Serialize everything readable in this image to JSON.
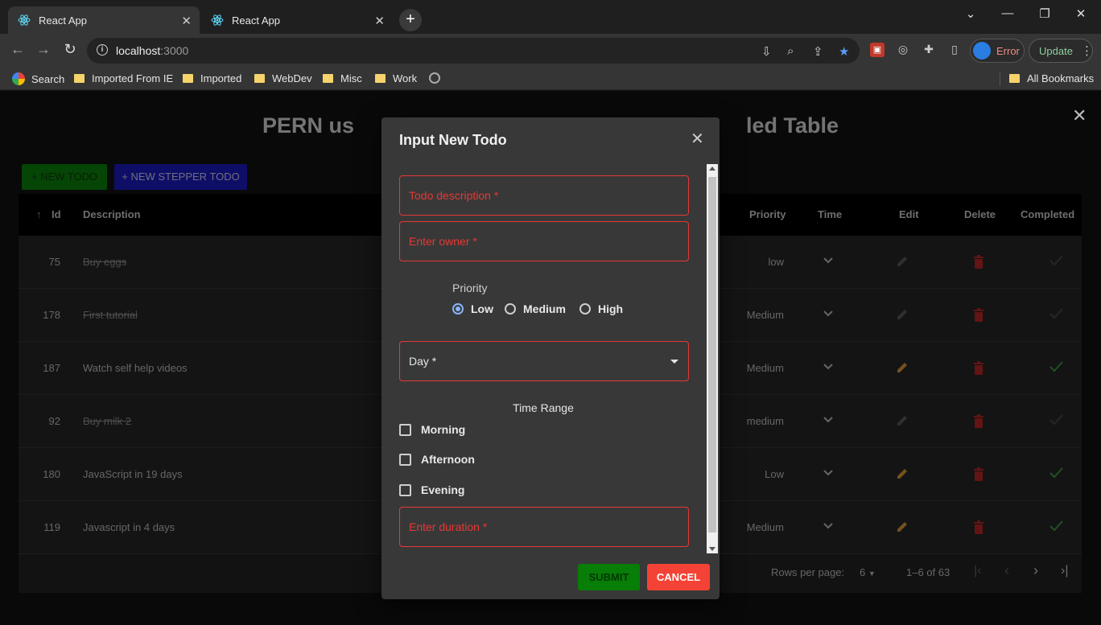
{
  "browser": {
    "tabs": [
      {
        "label": "React App"
      },
      {
        "label": "React App"
      }
    ],
    "url_host": "localhost",
    "url_port": ":3000",
    "profile_status": "Error",
    "update_label": "Update",
    "bookmarks": [
      {
        "label": "Search",
        "icon": "google-icon"
      },
      {
        "label": "Imported From IE",
        "icon": "folder-icon"
      },
      {
        "label": "Imported",
        "icon": "folder-icon"
      },
      {
        "label": "WebDev",
        "icon": "folder-icon"
      },
      {
        "label": "Misc",
        "icon": "folder-icon"
      },
      {
        "label": "Work",
        "icon": "folder-icon"
      }
    ],
    "all_bookmarks": "All Bookmarks"
  },
  "page": {
    "title_left": "PERN us",
    "title_right": "led Table",
    "new_todo_label": "+ NEW TODO",
    "new_stepper_label": "+ NEW STEPPER TODO"
  },
  "table": {
    "headers": {
      "id": "Id",
      "description": "Description",
      "priority": "Priority",
      "time": "Time",
      "edit": "Edit",
      "delete": "Delete",
      "completed": "Completed"
    },
    "rows": [
      {
        "id": "75",
        "description": "Buy eggs",
        "priority": "low",
        "done": true
      },
      {
        "id": "178",
        "description": "First tutorial",
        "priority": "Medium",
        "done": true
      },
      {
        "id": "187",
        "description": "Watch self help videos",
        "priority": "Medium",
        "done": false
      },
      {
        "id": "92",
        "description": "Buy milk 2",
        "priority": "medium",
        "done": true
      },
      {
        "id": "180",
        "description": "JavaScript in 19 days",
        "priority": "Low",
        "done": false
      },
      {
        "id": "119",
        "description": "Javascript in 4 days",
        "priority": "Medium",
        "done": false
      }
    ],
    "footer": {
      "rows_per_page_label": "Rows per page:",
      "rows_per_page_value": "6",
      "range": "1–6 of 63"
    }
  },
  "dialog": {
    "title": "Input New Todo",
    "description_placeholder": "Todo description *",
    "owner_placeholder": "Enter owner *",
    "priority_label": "Priority",
    "priority_options": [
      "Low",
      "Medium",
      "High"
    ],
    "priority_selected": "Low",
    "day_label": "Day *",
    "time_range_label": "Time Range",
    "time_options": [
      "Morning",
      "Afternoon",
      "Evening"
    ],
    "duration_placeholder": "Enter duration *",
    "submit_label": "SUBMIT",
    "cancel_label": "CANCEL"
  },
  "colors": {
    "error": "#e53935",
    "edit_active": "#e8a33a",
    "delete": "#c62828",
    "complete_active": "#43a047"
  }
}
